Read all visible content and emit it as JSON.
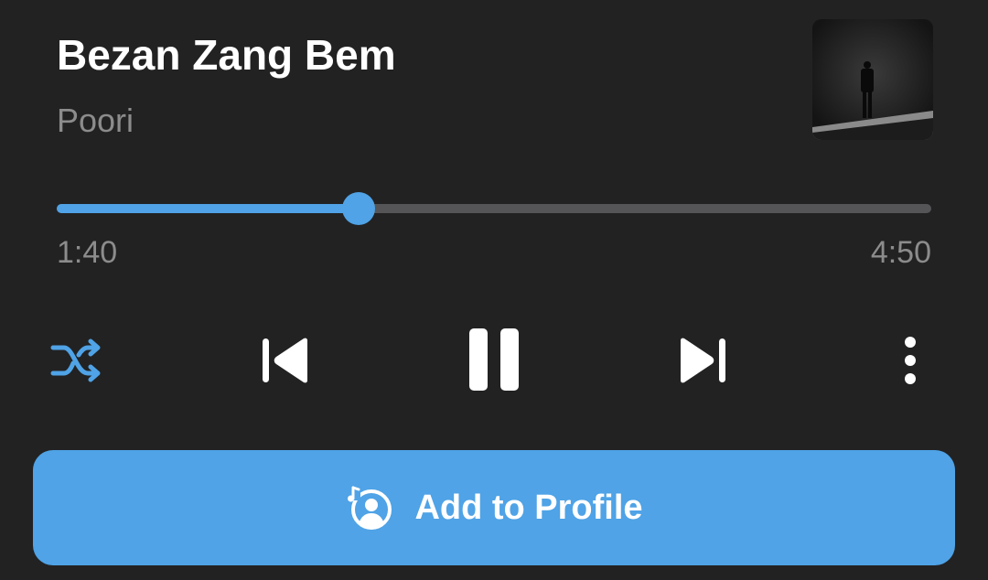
{
  "track": {
    "title": "Bezan Zang Bem",
    "artist": "Poori"
  },
  "artwork": {
    "icon": "album-artwork-silhouette"
  },
  "playback": {
    "elapsed": "1:40",
    "total": "4:50",
    "progress_fraction": 0.345,
    "state": "playing"
  },
  "controls": {
    "shuffle_icon": "shuffle-icon",
    "shuffle_active": true,
    "previous_icon": "skip-previous-icon",
    "pause_icon": "pause-icon",
    "next_icon": "skip-next-icon",
    "more_icon": "more-vertical-icon"
  },
  "add_to_profile": {
    "label": "Add to Profile",
    "icon": "music-profile-icon"
  },
  "colors": {
    "background": "#222223",
    "accent": "#4fa3e6",
    "text_primary": "#ffffff",
    "text_secondary": "#8c8c8c",
    "track_inactive": "#555557"
  }
}
